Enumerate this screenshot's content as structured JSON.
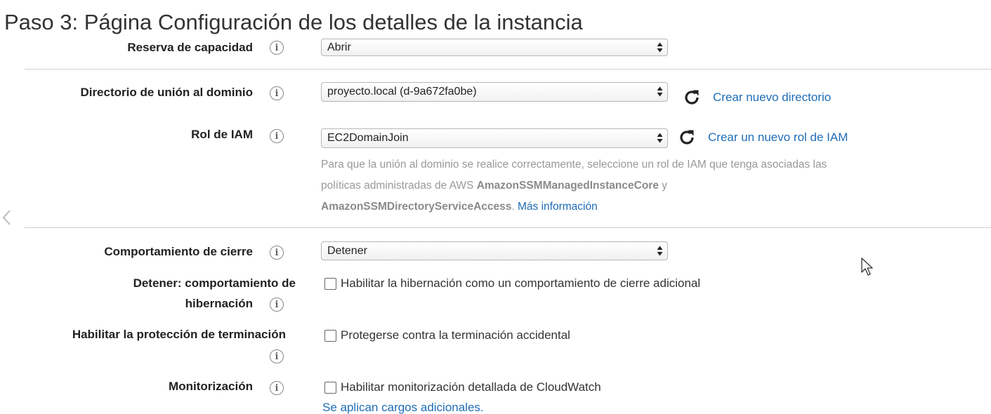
{
  "title": "Paso 3: Página Configuración de los detalles de la instancia",
  "capacity_reservation": {
    "label": "Reserva de capacidad",
    "value": "Abrir"
  },
  "domain_join": {
    "label": "Directorio de unión al dominio",
    "value": "proyecto.local (d-9a672fa0be)",
    "create_link": "Crear nuevo directorio"
  },
  "iam_role": {
    "label": "Rol de IAM",
    "value": "EC2DomainJoin",
    "create_link": "Crear un nuevo rol de IAM",
    "help_part1": "Para que la unión al dominio se realice correctamente, seleccione un rol de IAM que tenga asociadas las políticas administradas de AWS ",
    "help_policy1": "AmazonSSMManagedInstanceCore",
    "help_and": " y ",
    "help_policy2": "AmazonSSMDirectoryServiceAccess",
    "help_dot": ". ",
    "help_more": "Más información"
  },
  "shutdown_behavior": {
    "label": "Comportamiento de cierre",
    "value": "Detener"
  },
  "hibernation": {
    "label_line1": "Detener: comportamiento de",
    "label_line2": "hibernación",
    "checkbox_label": "Habilitar la hibernación como un comportamiento de cierre adicional",
    "checked": false
  },
  "termination_protection": {
    "label": "Habilitar la protección de terminación",
    "checkbox_label": "Protegerse contra la terminación accidental",
    "checked": false
  },
  "monitoring": {
    "label": "Monitorización",
    "checkbox_label": "Habilitar monitorización detallada de CloudWatch",
    "checked": false,
    "charges_link": "Se aplican cargos adicionales."
  },
  "colors": {
    "link": "#1f6db6",
    "help_text": "#999999",
    "divider": "#cfcfcf"
  }
}
